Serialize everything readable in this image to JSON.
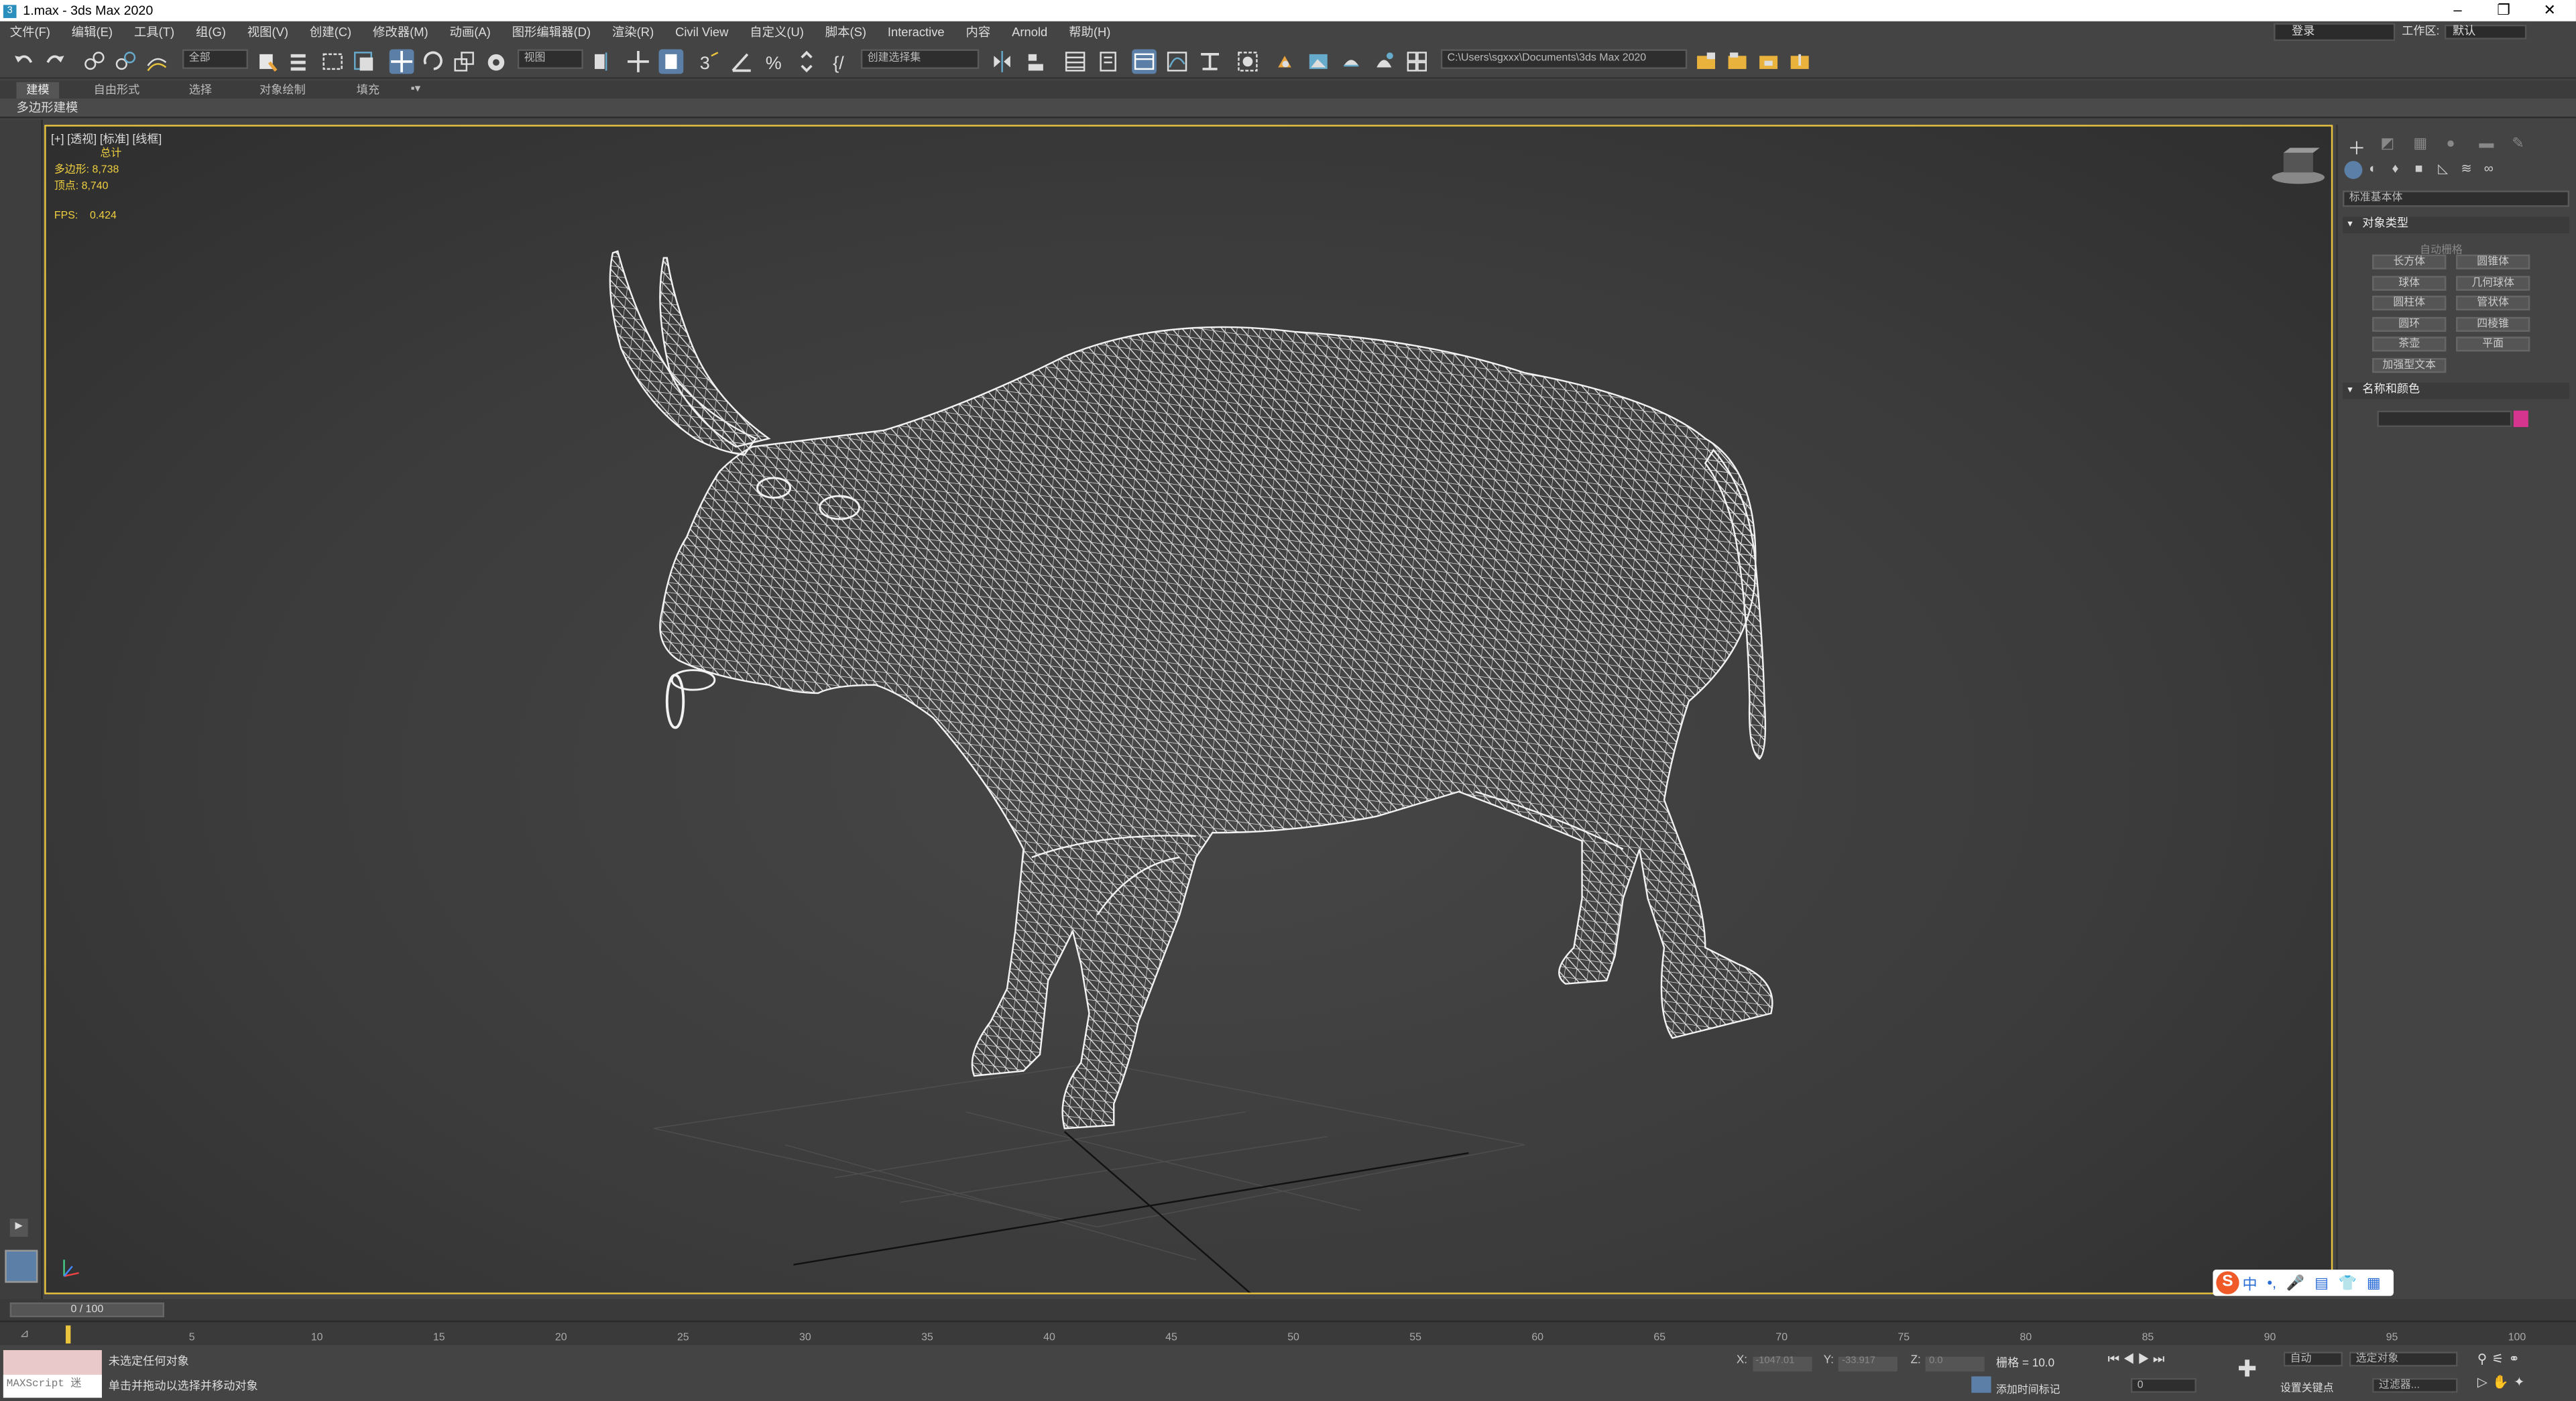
{
  "title": "1.max - 3ds Max 2020",
  "window_controls": [
    "–",
    "❐",
    "✕"
  ],
  "menu": [
    "文件(F)",
    "编辑(E)",
    "工具(T)",
    "组(G)",
    "视图(V)",
    "创建(C)",
    "修改器(M)",
    "动画(A)",
    "图形编辑器(D)",
    "渲染(R)",
    "Civil View",
    "自定义(U)",
    "脚本(S)",
    "Interactive",
    "内容",
    "Arnold",
    "帮助(H)"
  ],
  "login": "登录",
  "workspace": {
    "label": "工作区:",
    "value": "默认"
  },
  "toolbar": {
    "filter": "全部",
    "ref_coord": "视图",
    "selection_set": "创建选择集",
    "path": "C:\\Users\\sgxxx\\Documents\\3ds Max 2020"
  },
  "ribbon_tabs": [
    "建模",
    "自由形式",
    "选择",
    "对象绘制",
    "填充"
  ],
  "ribbon_sub": "多边形建模",
  "viewport": {
    "label": "[+] [透视] [标准] [线框]",
    "stats_header": "总计",
    "polys_label": "多边形:",
    "polys": "8,738",
    "verts_label": "顶点:",
    "verts": "8,740",
    "fps_label": "FPS:",
    "fps": "0.424"
  },
  "command_panel": {
    "category": "标准基本体",
    "rollout_object_type": "对象类型",
    "autogrid": "自动栅格",
    "objects": [
      "长方体",
      "圆锥体",
      "球体",
      "几何球体",
      "圆柱体",
      "管状体",
      "圆环",
      "四棱锥",
      "茶壶",
      "平面",
      "加强型文本"
    ],
    "rollout_name_color": "名称和颜色",
    "color": "#d6358f"
  },
  "timeline": {
    "frame": "0 / 100",
    "ticks": [
      "5",
      "10",
      "15",
      "20",
      "25",
      "30",
      "35",
      "40",
      "45",
      "50",
      "55",
      "60",
      "65",
      "70",
      "75",
      "80",
      "85",
      "90",
      "95",
      "100"
    ]
  },
  "status": {
    "maxscript": "MAXScript 迷",
    "line1": "未选定任何对象",
    "line2": "单击并拖动以选择并移动对象",
    "x_label": "X:",
    "x": "-1047.01",
    "y_label": "Y:",
    "y": "-33.917",
    "z_label": "Z:",
    "z": "0.0",
    "grid": "栅格 = 10.0",
    "add_tag": "添加时间标记",
    "auto_key": "自动",
    "set_key": "设置关键点",
    "selected": "选定对象",
    "filters": "过滤器...",
    "frame_value": "0"
  },
  "ime": {
    "logo": "S",
    "items": [
      "中",
      "•,",
      "🎤",
      "▤",
      "👕",
      "▦"
    ]
  }
}
